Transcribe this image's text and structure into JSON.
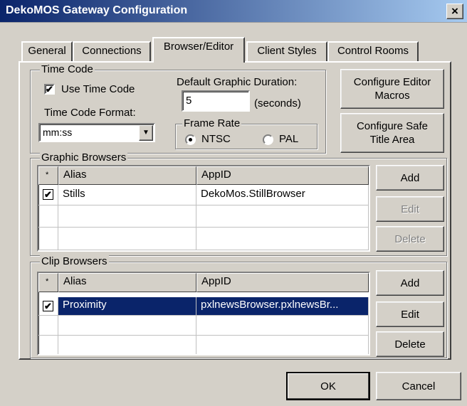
{
  "window": {
    "title": "DekoMOS Gateway Configuration",
    "close_glyph": "×"
  },
  "tabs": [
    "General",
    "Connections",
    "Browser/Editor",
    "Client Styles",
    "Control Rooms"
  ],
  "active_tab": "Browser/Editor",
  "time_code": {
    "legend": "Time Code",
    "use_checkbox_label": "Use Time Code",
    "use_checked": true,
    "format_label": "Time Code Format:",
    "format_value": "mm:ss"
  },
  "duration": {
    "label": "Default Graphic Duration:",
    "value": "5",
    "unit": "(seconds)"
  },
  "frame_rate": {
    "legend": "Frame Rate",
    "options": [
      "NTSC",
      "PAL"
    ],
    "selected": "NTSC"
  },
  "buttons": {
    "macros": "Configure Editor Macros",
    "safe_title": "Configure Safe Title Area",
    "ok": "OK",
    "cancel": "Cancel"
  },
  "graphic_browsers": {
    "legend": "Graphic Browsers",
    "columns": [
      "*",
      "Alias",
      "AppID"
    ],
    "rows": [
      {
        "checked": true,
        "alias": "Stills",
        "appid": "DekoMos.StillBrowser"
      }
    ],
    "buttons": {
      "add": "Add",
      "edit": "Edit",
      "delete": "Delete"
    }
  },
  "clip_browsers": {
    "legend": "Clip Browsers",
    "columns": [
      "*",
      "Alias",
      "AppID"
    ],
    "rows": [
      {
        "checked": true,
        "alias": "Proximity",
        "appid": "pxlnewsBrowser.pxlnewsBr..."
      }
    ],
    "buttons": {
      "add": "Add",
      "edit": "Edit",
      "delete": "Delete"
    }
  },
  "check_glyph": "✔",
  "combo_glyph": "▼"
}
